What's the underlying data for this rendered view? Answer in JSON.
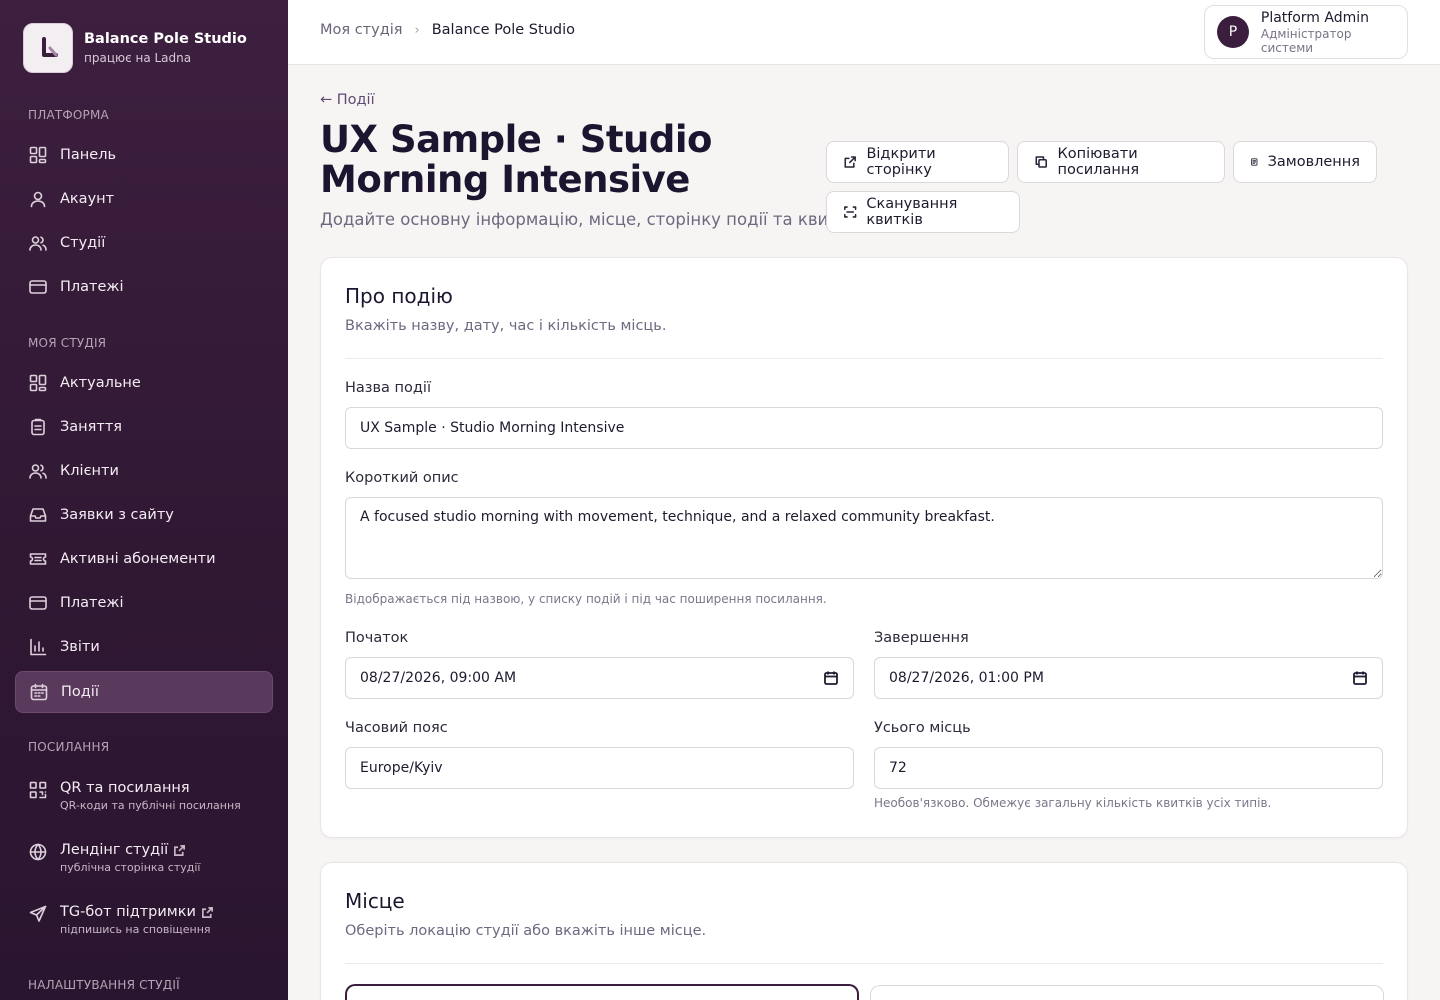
{
  "sidebar": {
    "brand": {
      "name": "Balance Pole Studio",
      "sub": "працює на Ladna",
      "logo_icon": "studio-logo-icon"
    },
    "sections": {
      "platform": "ПЛАТФОРМА",
      "my_studio": "МОЯ СТУДІЯ",
      "links": "ПОСИЛАННЯ",
      "studio_settings": "НАЛАШТУВАННЯ СТУДІЇ"
    },
    "platform_items": [
      {
        "label": "Панель",
        "icon": "dashboard-grid-icon"
      },
      {
        "label": "Акаунт",
        "icon": "user-icon"
      },
      {
        "label": "Студії",
        "icon": "users-icon"
      },
      {
        "label": "Платежі",
        "icon": "credit-card-icon"
      }
    ],
    "studio_items": [
      {
        "label": "Актуальне",
        "icon": "dashboard-grid-icon"
      },
      {
        "label": "Заняття",
        "icon": "clipboard-icon"
      },
      {
        "label": "Клієнти",
        "icon": "users-icon"
      },
      {
        "label": "Заявки з сайту",
        "icon": "inbox-icon"
      },
      {
        "label": "Активні абонементи",
        "icon": "ticket-icon"
      },
      {
        "label": "Платежі",
        "icon": "credit-card-icon"
      },
      {
        "label": "Звіти",
        "icon": "bar-chart-icon"
      },
      {
        "label": "Події",
        "icon": "calendar-icon",
        "active": true
      }
    ],
    "link_items": [
      {
        "label": "QR та посилання",
        "sub": "QR-коди та публічні посилання",
        "icon": "qr-code-icon"
      },
      {
        "label": "Лендінг студії",
        "sub": "публічна сторінка студії",
        "icon": "globe-icon"
      },
      {
        "label": "TG-бот підтримки",
        "sub": "підпишись на сповіщення",
        "icon": "send-icon"
      }
    ]
  },
  "header": {
    "breadcrumb": {
      "parent": "Моя студія",
      "current": "Balance Pole Studio"
    },
    "user": {
      "initial": "P",
      "name": "Platform Admin",
      "role": "Адміністратор системи"
    }
  },
  "page": {
    "back": "← Події",
    "title": "UX Sample · Studio Morning Intensive",
    "subtitle": "Додайте основну інформацію, місце, сторінку події та квитки.",
    "actions": {
      "open_page": "Відкрити сторінку",
      "copy_link": "Копіювати посилання",
      "orders": "Замовлення",
      "scan_tickets": "Сканування квитків"
    }
  },
  "about": {
    "title": "Про подію",
    "subtitle": "Вкажіть назву, дату, час і кількість місць.",
    "name_label": "Назва події",
    "name_value": "UX Sample · Studio Morning Intensive",
    "desc_label": "Короткий опис",
    "desc_value": "A focused studio morning with movement, technique, and a relaxed community breakfast.",
    "desc_hint": "Відображається під назвою, у списку подій і під час поширення посилання.",
    "start_label": "Початок",
    "start_value": "08/27/2026, 09:00 AM",
    "end_label": "Завершення",
    "end_value": "08/27/2026, 01:00 PM",
    "tz_label": "Часовий пояс",
    "tz_value": "Europe/Kyiv",
    "seats_label": "Усього місць",
    "seats_value": "72",
    "seats_hint": "Необов'язково. Обмежує загальну кількість квитків усіх типів."
  },
  "place": {
    "title": "Місце",
    "subtitle": "Оберіть локацію студії або вкажіть інше місце."
  },
  "colors": {
    "sidebar_bg": "#3d1f3f",
    "accent": "#3b1e3d",
    "active_item": "#5a3a5c"
  }
}
